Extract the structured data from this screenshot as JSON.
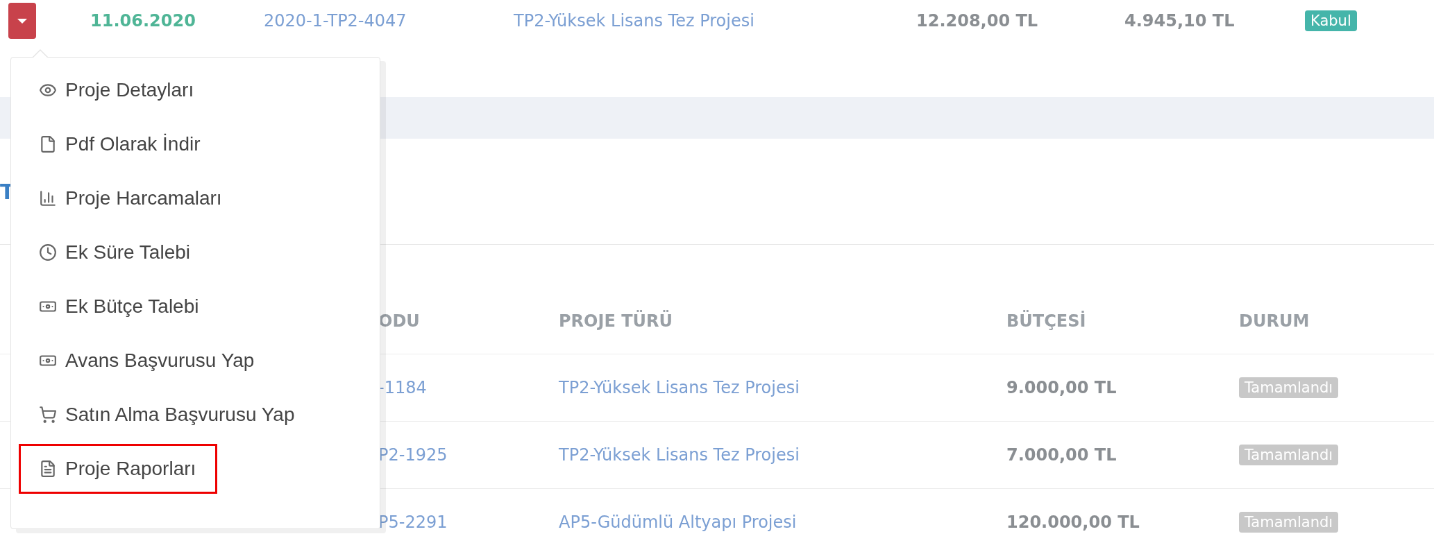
{
  "project_row": {
    "date": "11.06.2020",
    "code": "2020-1-TP2-4047",
    "type": "TP2-Yüksek Lisans Tez Projesi",
    "budget": "12.208,00 TL",
    "spent": "4.945,10 TL",
    "status": {
      "label": "Kabul",
      "kind": "accepted"
    }
  },
  "dropdown": {
    "items": [
      {
        "label": "Proje Detayları",
        "selected": false
      },
      {
        "label": "Pdf Olarak İndir",
        "selected": false
      },
      {
        "label": "Proje Harcamaları",
        "selected": false
      },
      {
        "label": "Ek Süre Talebi",
        "selected": false
      },
      {
        "label": "Ek Bütçe Talebi",
        "selected": false
      },
      {
        "label": "Avans Başvurusu Yap",
        "selected": false
      },
      {
        "label": "Satın Alma Başvurusu Yap",
        "selected": false
      },
      {
        "label": "Proje Raporları",
        "selected": true
      }
    ]
  },
  "section_heading": "T",
  "table": {
    "columns": [
      "ODU",
      "PROJE TÜRÜ",
      "BÜTÇESİ",
      "DURUM"
    ],
    "rows": [
      {
        "code": "-1184",
        "type": "TP2-Yüksek Lisans Tez Projesi",
        "budget": "9.000,00 TL",
        "status": {
          "label": "Tamamlandı",
          "kind": "completed"
        }
      },
      {
        "code": "P2-1925",
        "type": "TP2-Yüksek Lisans Tez Projesi",
        "budget": "7.000,00 TL",
        "status": {
          "label": "Tamamlandı",
          "kind": "completed"
        }
      },
      {
        "code": "P5-2291",
        "type": "AP5-Güdümlü Altyapı Projesi",
        "budget": "120.000,00 TL",
        "status": {
          "label": "Tamamlandı",
          "kind": "completed"
        }
      }
    ]
  }
}
